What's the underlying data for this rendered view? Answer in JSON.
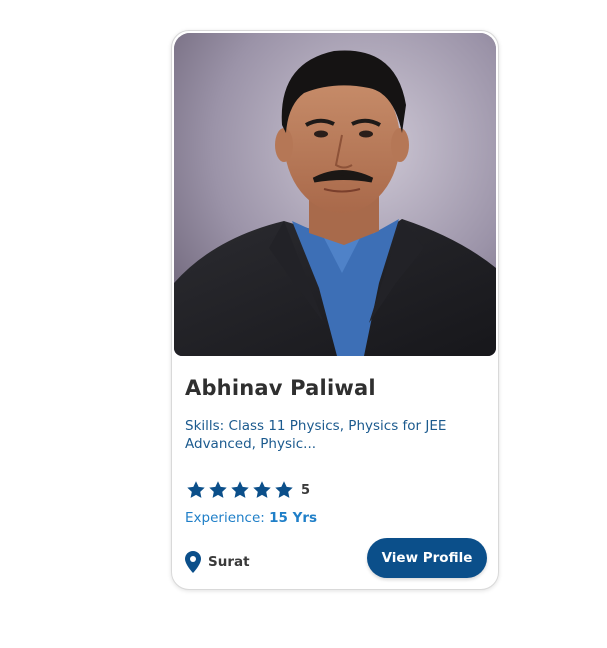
{
  "profile": {
    "name": "Abhinav Paliwal",
    "skills": "Skills: Class 11 Physics, Physics for JEE Advanced, Physic...",
    "rating": {
      "stars": 5,
      "max_stars": 5,
      "value_label": "5"
    },
    "experience_label": "Experience:",
    "experience_value": "15 Yrs",
    "location": "Surat",
    "view_profile_label": "View Profile"
  },
  "colors": {
    "accent": "#0b4f8a",
    "star": "#0b4f8a",
    "experience_text": "#1f7fc8",
    "skills_text": "#1b5a8e"
  },
  "icons": {
    "rating": "star-icon",
    "location": "location-pin-icon"
  }
}
